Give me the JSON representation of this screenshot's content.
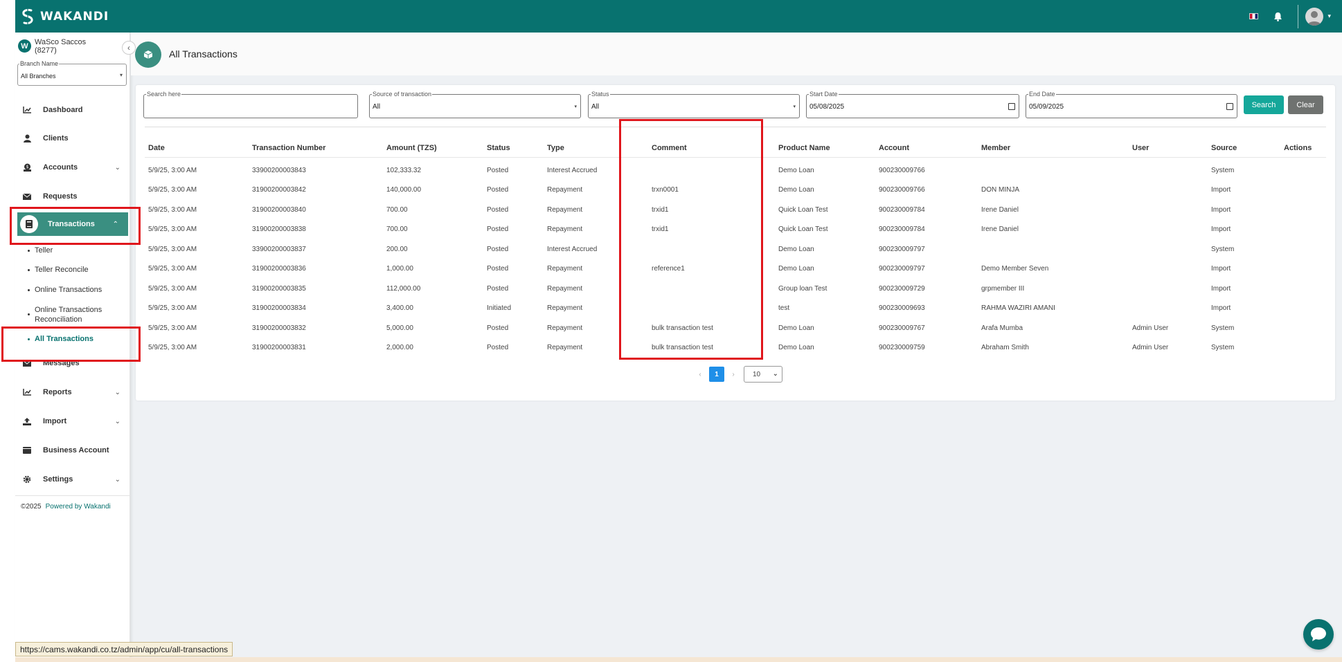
{
  "app": {
    "brand": "WAKANDI"
  },
  "org": {
    "badge": "W",
    "name": "WaSco Saccos (8277)"
  },
  "branch": {
    "label": "Branch Name",
    "value": "All Branches"
  },
  "nav": {
    "items": [
      {
        "label": "Dashboard",
        "icon": "chart-line-icon"
      },
      {
        "label": "Clients",
        "icon": "user-icon"
      },
      {
        "label": "Accounts",
        "icon": "money-icon"
      },
      {
        "label": "Requests",
        "icon": "envelope-icon"
      },
      {
        "label": "Transactions",
        "icon": "book-icon"
      },
      {
        "label": "Messages",
        "icon": "envelope-icon"
      },
      {
        "label": "Reports",
        "icon": "chart-line-icon"
      },
      {
        "label": "Import",
        "icon": "upload-icon"
      },
      {
        "label": "Business Account",
        "icon": "wallet-icon"
      },
      {
        "label": "Settings",
        "icon": "gear-icon"
      }
    ],
    "transactions_sub": [
      "Teller",
      "Teller Reconcile",
      "Online Transactions",
      "Online Transactions Reconciliation",
      "All Transactions"
    ]
  },
  "footer": {
    "copyright": "©2025",
    "powered": "Powered by Wakandi"
  },
  "page": {
    "title": "All Transactions"
  },
  "filters": {
    "search_label": "Search here",
    "source_label": "Source of transaction",
    "source_value": "All",
    "status_label": "Status",
    "status_value": "All",
    "start_label": "Start Date",
    "start_value": "05/08/2025",
    "end_label": "End Date",
    "end_value": "05/09/2025",
    "search_btn": "Search",
    "clear_btn": "Clear"
  },
  "table": {
    "headers": [
      "Date",
      "Transaction Number",
      "Amount (TZS)",
      "Status",
      "Type",
      "Comment",
      "Product Name",
      "Account",
      "Member",
      "User",
      "Source",
      "Actions"
    ],
    "rows": [
      [
        "5/9/25, 3:00 AM",
        "33900200003843",
        "102,333.32",
        "Posted",
        "Interest Accrued",
        "",
        "Demo Loan",
        "900230009766",
        "",
        "",
        "System"
      ],
      [
        "5/9/25, 3:00 AM",
        "31900200003842",
        "140,000.00",
        "Posted",
        "Repayment",
        "trxn0001",
        "Demo Loan",
        "900230009766",
        "DON MINJA",
        "",
        "Import"
      ],
      [
        "5/9/25, 3:00 AM",
        "31900200003840",
        "700.00",
        "Posted",
        "Repayment",
        "trxid1",
        "Quick Loan Test",
        "900230009784",
        "Irene Daniel",
        "",
        "Import"
      ],
      [
        "5/9/25, 3:00 AM",
        "31900200003838",
        "700.00",
        "Posted",
        "Repayment",
        "trxid1",
        "Quick Loan Test",
        "900230009784",
        "Irene Daniel",
        "",
        "Import"
      ],
      [
        "5/9/25, 3:00 AM",
        "33900200003837",
        "200.00",
        "Posted",
        "Interest Accrued",
        "",
        "Demo Loan",
        "900230009797",
        "",
        "",
        "System"
      ],
      [
        "5/9/25, 3:00 AM",
        "31900200003836",
        "1,000.00",
        "Posted",
        "Repayment",
        "reference1",
        "Demo Loan",
        "900230009797",
        "Demo Member Seven",
        "",
        "Import"
      ],
      [
        "5/9/25, 3:00 AM",
        "31900200003835",
        "112,000.00",
        "Posted",
        "Repayment",
        "",
        "Group loan Test",
        "900230009729",
        "grpmember III",
        "",
        "Import"
      ],
      [
        "5/9/25, 3:00 AM",
        "31900200003834",
        "3,400.00",
        "Initiated",
        "Repayment",
        "",
        "test",
        "900230009693",
        "RAHMA WAZIRI AMANI",
        "",
        "Import"
      ],
      [
        "5/9/25, 3:00 AM",
        "31900200003832",
        "5,000.00",
        "Posted",
        "Repayment",
        "bulk transaction test",
        "Demo Loan",
        "900230009767",
        "Arafa Mumba",
        "Admin User",
        "System"
      ],
      [
        "5/9/25, 3:00 AM",
        "31900200003831",
        "2,000.00",
        "Posted",
        "Repayment",
        "bulk transaction test",
        "Demo Loan",
        "900230009759",
        "Abraham Smith",
        "Admin User",
        "System"
      ]
    ]
  },
  "pagination": {
    "current": "1",
    "page_size": "10"
  },
  "status_url": "https://cams.wakandi.co.tz/admin/app/cu/all-transactions",
  "colors": {
    "primary": "#08726f",
    "active_nav": "#3a8f81",
    "search_btn": "#15a79a",
    "clear_btn": "#6f7270",
    "highlight": "#e0161c",
    "page_active": "#1f8fe8"
  }
}
